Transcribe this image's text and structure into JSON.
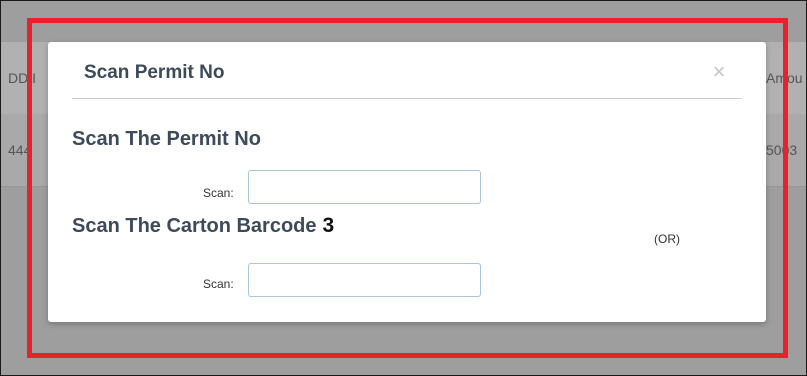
{
  "background": {
    "col_header_left": "DD I",
    "col_header_right": "Amou",
    "row_value_left": "444",
    "row_value_right": "5003"
  },
  "modal": {
    "title": "Scan Permit No",
    "close_symbol": "×",
    "close_icon": "close-icon",
    "permit_section": {
      "title": "Scan The Permit No",
      "scan_label": "Scan:",
      "value": "",
      "placeholder": ""
    },
    "carton_section": {
      "title": "Scan The Carton Barcode",
      "badge": "3",
      "scan_label": "Scan:",
      "value": "",
      "placeholder": ""
    },
    "or_text": "(OR)"
  },
  "colors": {
    "highlight": "#e8222b",
    "title_text": "#3d4a5a",
    "backdrop": "#9e9e9e"
  }
}
